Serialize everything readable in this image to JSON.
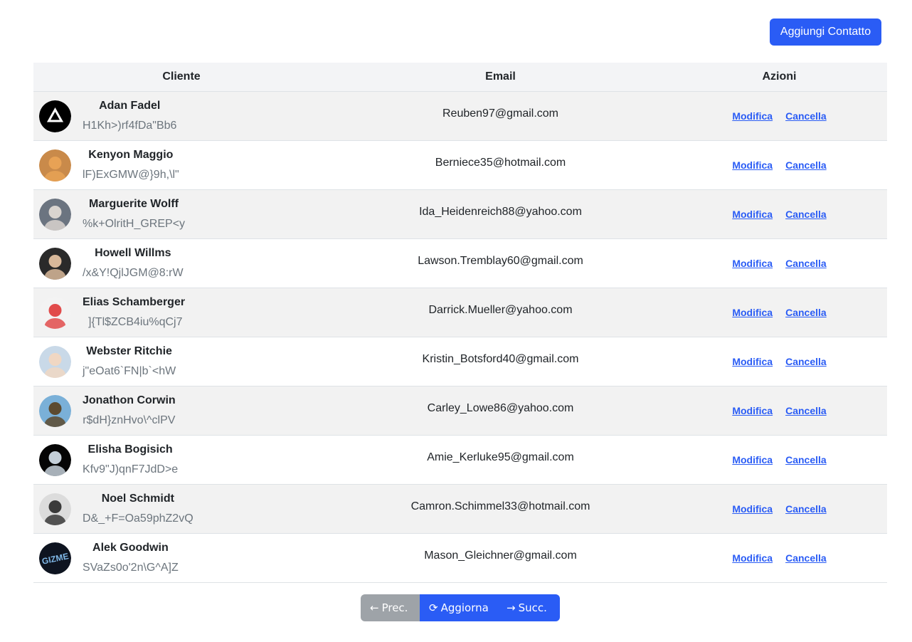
{
  "toolbar": {
    "add_contact_label": "Aggiungi Contatto"
  },
  "table": {
    "headers": {
      "client": "Cliente",
      "email": "Email",
      "actions": "Azioni"
    },
    "rows": [
      {
        "name": "Adan Fadel",
        "code": "H1Kh>)rf4fDa\"Bb6",
        "email": "Reuben97@gmail.com",
        "edit": "Modifica",
        "delete": "Cancella"
      },
      {
        "name": "Kenyon Maggio",
        "code": "lF)ExGMW@}9h,\\l\"",
        "email": "Berniece35@hotmail.com",
        "edit": "Modifica",
        "delete": "Cancella"
      },
      {
        "name": "Marguerite Wolff",
        "code": "%k+OlritH_GREP<y",
        "email": "Ida_Heidenreich88@yahoo.com",
        "edit": "Modifica",
        "delete": "Cancella"
      },
      {
        "name": "Howell Willms",
        "code": "/x&Y!QjlJGM@8:rW",
        "email": "Lawson.Tremblay60@gmail.com",
        "edit": "Modifica",
        "delete": "Cancella"
      },
      {
        "name": "Elias Schamberger",
        "code": " ]{Tl$ZCB4iu%qCj7",
        "email": "Darrick.Mueller@yahoo.com",
        "edit": "Modifica",
        "delete": "Cancella"
      },
      {
        "name": "Webster Ritchie",
        "code": "j\"eOat6`FN|b`<hW",
        "email": "Kristin_Botsford40@gmail.com",
        "edit": "Modifica",
        "delete": "Cancella"
      },
      {
        "name": "Jonathon Corwin",
        "code": "r$dH}znHvo\\^clPV",
        "email": "Carley_Lowe86@yahoo.com",
        "edit": "Modifica",
        "delete": "Cancella"
      },
      {
        "name": "Elisha Bogisich",
        "code": "Kfv9\"J)qnF7JdD>e",
        "email": "Amie_Kerluke95@gmail.com",
        "edit": "Modifica",
        "delete": "Cancella"
      },
      {
        "name": "Noel Schmidt",
        "code": "D&_+F=Oa59phZ2vQ",
        "email": "Camron.Schimmel33@hotmail.com",
        "edit": "Modifica",
        "delete": "Cancella"
      },
      {
        "name": "Alek Goodwin",
        "code": "SVaZs0o'2n\\G^A]Z",
        "email": "Mason_Gleichner@gmail.com",
        "edit": "Modifica",
        "delete": "Cancella"
      }
    ]
  },
  "avatars": [
    {
      "bg": "#000000",
      "fg": "#ffffff",
      "kind": "logo-triangle"
    },
    {
      "bg": "#c98a4a",
      "fg": "#e8a255",
      "kind": "photo"
    },
    {
      "bg": "#6b7480",
      "fg": "#d9d4cf",
      "kind": "photo"
    },
    {
      "bg": "#2a2a2a",
      "fg": "#d8b89a",
      "kind": "photo"
    },
    {
      "bg": "#f3f3f3",
      "fg": "#e14b4b",
      "kind": "photo"
    },
    {
      "bg": "#c9d9e8",
      "fg": "#f0d7c3",
      "kind": "photo"
    },
    {
      "bg": "#7ab0d8",
      "fg": "#5c4a2f",
      "kind": "photo"
    },
    {
      "bg": "#050505",
      "fg": "#c4cfd8",
      "kind": "photo"
    },
    {
      "bg": "#dcdcdc",
      "fg": "#3a3a3a",
      "kind": "photo"
    },
    {
      "bg": "#0e1420",
      "fg": "#7fb7e6",
      "kind": "logo-text",
      "text": "GIZME"
    }
  ],
  "pager": {
    "prev_icon": "arrow-left-icon",
    "prev_label": "Prec.",
    "refresh_icon": "refresh-icon",
    "refresh_label": "Aggiorna",
    "next_icon": "arrow-right-icon",
    "next_label": "Succ."
  },
  "colors": {
    "primary": "#2a5cf5",
    "secondary": "#9ea3a8",
    "stripe": "#f2f2f2",
    "header_bg": "#f3f4f6"
  }
}
